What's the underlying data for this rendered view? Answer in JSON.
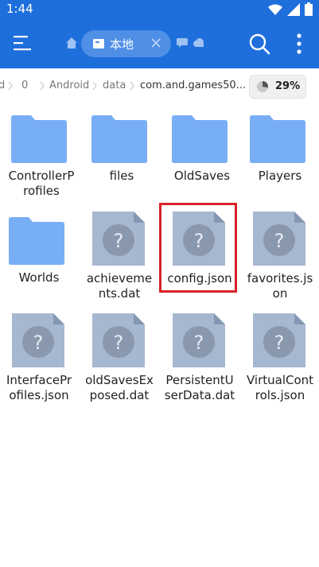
{
  "status_bar": {
    "time": "1:44"
  },
  "app_bar": {
    "tab_label": "本地"
  },
  "breadcrumb": {
    "items": [
      "d",
      "0",
      "Android",
      "data",
      "com.and.games50..."
    ],
    "storage_percent": "29%"
  },
  "files": [
    {
      "name_line1": "ControllerP",
      "name_line2": "rofiles",
      "type": "folder"
    },
    {
      "name_line1": "files",
      "name_line2": "",
      "type": "folder"
    },
    {
      "name_line1": "OldSaves",
      "name_line2": "",
      "type": "folder"
    },
    {
      "name_line1": "Players",
      "name_line2": "",
      "type": "folder"
    },
    {
      "name_line1": "Worlds",
      "name_line2": "",
      "type": "folder"
    },
    {
      "name_line1": "achieveme",
      "name_line2": "nts.dat",
      "type": "file"
    },
    {
      "name_line1": "config.json",
      "name_line2": "",
      "type": "file"
    },
    {
      "name_line1": "favorites.js",
      "name_line2": "on",
      "type": "file"
    },
    {
      "name_line1": "InterfacePr",
      "name_line2": "ofiles.json",
      "type": "file"
    },
    {
      "name_line1": "oldSavesEx",
      "name_line2": "posed.dat",
      "type": "file"
    },
    {
      "name_line1": "PersistentU",
      "name_line2": "serData.dat",
      "type": "file"
    },
    {
      "name_line1": "VirtualCont",
      "name_line2": "rols.json",
      "type": "file"
    }
  ],
  "colors": {
    "accent": "#1e6fdc",
    "folder": "#78aef5",
    "file": "#a6b7d0",
    "highlight": "#d9222a"
  },
  "icons": {
    "menu": "menu-icon",
    "home": "home-icon",
    "tab": "storage-tab-icon",
    "close": "close-icon",
    "chat": "chat-icon",
    "cloud": "cloud-icon",
    "search": "search-icon",
    "more": "more-vertical-icon",
    "storage": "pie-chart-icon",
    "folder": "folder-icon",
    "unknown_file": "unknown-file-icon"
  }
}
